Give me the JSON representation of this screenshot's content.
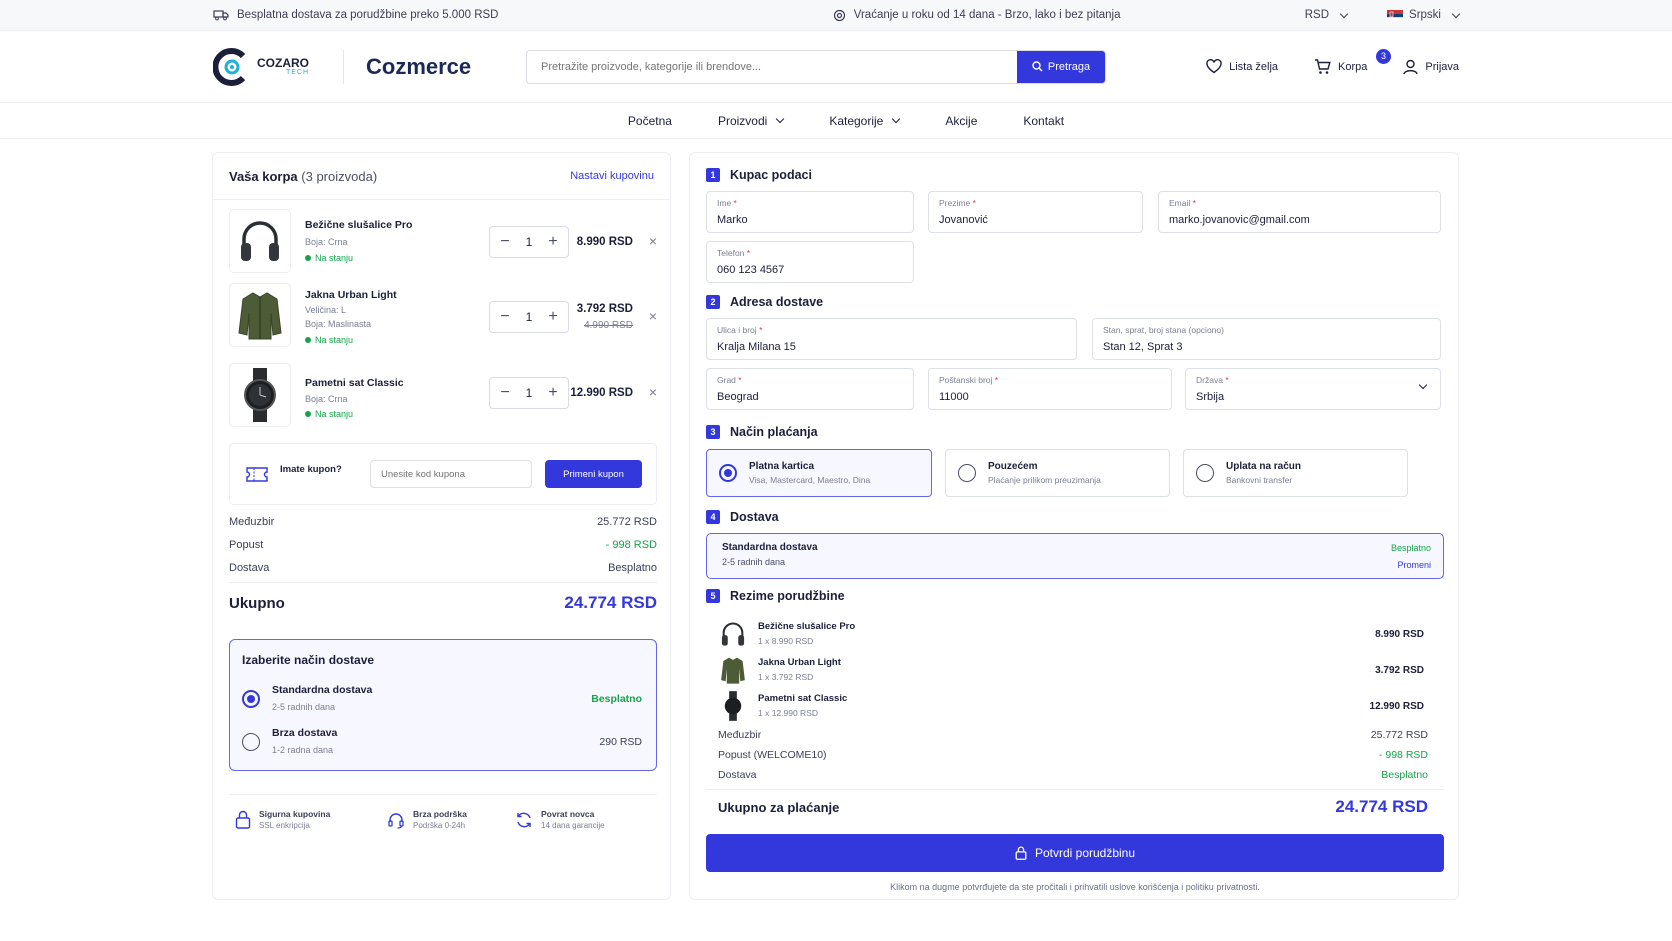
{
  "topbar": {
    "shipping_notice": "Besplatna dostava za porudžbine preko 5.000 RSD",
    "return_notice": "Vraćanje u roku od 14 dana - Brzo, lako i bez pitanja",
    "currency": "RSD",
    "language": "Srpski"
  },
  "header": {
    "logo_main": "COZARO",
    "logo_sub": "TECH",
    "brand": "Cozmerce",
    "search_placeholder": "Pretražite proizvode, kategorije ili brendove...",
    "search_button": "Pretraga",
    "wishlist": "Lista želja",
    "cart": "Korpa",
    "cart_count": "3",
    "login": "Prijava"
  },
  "nav": {
    "items": [
      "Početna",
      "Proizvodi",
      "Kategorije",
      "Akcije",
      "Kontakt"
    ]
  },
  "cart": {
    "title": "Vaša korpa",
    "count_label": "(3 proizvoda)",
    "continue_link": "Nastavi kupovinu",
    "items": [
      {
        "name": "Bežične slušalice Pro",
        "meta1": "Boja: Crna",
        "meta2": "",
        "stock": "Na stanju",
        "qty": "1",
        "price": "8.990 RSD",
        "old_price": ""
      },
      {
        "name": "Jakna Urban Light",
        "meta1": "Veličina: L",
        "meta2": "Boja: Maslinasta",
        "stock": "Na stanju",
        "qty": "1",
        "price": "3.792 RSD",
        "old_price": "4.990 RSD"
      },
      {
        "name": "Pametni sat Classic",
        "meta1": "Boja: Crna",
        "meta2": "",
        "stock": "Na stanju",
        "qty": "1",
        "price": "12.990 RSD",
        "old_price": ""
      }
    ],
    "coupon": {
      "label": "Imate kupon?",
      "placeholder": "Unesite kod kupona",
      "button": "Primeni kupon"
    },
    "summary": {
      "subtotal_label": "Međuzbir",
      "subtotal": "25.772 RSD",
      "discount_label": "Popust",
      "discount": "- 998 RSD",
      "shipping_label": "Dostava",
      "shipping": "Besplatno",
      "total_label": "Ukupno",
      "total": "24.774 RSD"
    },
    "shipping_choice": {
      "title": "Izaberite način dostave",
      "options": [
        {
          "name": "Standardna dostava",
          "time": "2-5 radnih dana",
          "price": "Besplatno"
        },
        {
          "name": "Brza dostava",
          "time": "1-2 radna dana",
          "price": "290 RSD"
        }
      ]
    },
    "trust": [
      {
        "title": "Sigurna kupovina",
        "sub": "SSL enkripcija"
      },
      {
        "title": "Brza podrška",
        "sub": "Podrška 0-24h"
      },
      {
        "title": "Povrat novca",
        "sub": "14 dana garancije"
      }
    ]
  },
  "checkout": {
    "sections": {
      "s1": {
        "num": "1",
        "title": "Kupac podaci"
      },
      "s2": {
        "num": "2",
        "title": "Adresa dostave"
      },
      "s3": {
        "num": "3",
        "title": "Način plaćanja"
      },
      "s4": {
        "num": "4",
        "title": "Dostava"
      },
      "s5": {
        "num": "5",
        "title": "Rezime porudžbine"
      }
    },
    "fields": {
      "first_name": {
        "label": "Ime",
        "value": "Marko"
      },
      "last_name": {
        "label": "Prezime",
        "value": "Jovanović"
      },
      "email": {
        "label": "Email",
        "value": "marko.jovanovic@gmail.com"
      },
      "phone": {
        "label": "Telefon",
        "value": "060 123 4567"
      },
      "street": {
        "label": "Ulica i broj",
        "value": "Kralja Milana 15"
      },
      "apartment": {
        "label": "Stan, sprat, broj stana (opciono)",
        "value": "Stan 12, Sprat 3"
      },
      "city": {
        "label": "Grad",
        "value": "Beograd"
      },
      "postal": {
        "label": "Poštanski broj",
        "value": "11000"
      },
      "country": {
        "label": "Država",
        "value": "Srbija"
      }
    },
    "payment": [
      {
        "title": "Platna kartica",
        "sub": "Visa, Mastercard, Maestro, Dina"
      },
      {
        "title": "Pouzećem",
        "sub": "Plaćanje prilikom preuzimanja"
      },
      {
        "title": "Uplata na račun",
        "sub": "Bankovni transfer"
      }
    ],
    "delivery": {
      "name": "Standardna dostava",
      "time": "2-5 radnih dana",
      "price": "Besplatno",
      "change": "Promeni"
    },
    "order_items": [
      {
        "name": "Bežične slušalice Pro",
        "qty": "1 x 8.990 RSD",
        "price": "8.990 RSD"
      },
      {
        "name": "Jakna Urban Light",
        "qty": "1 x 3.792 RSD",
        "price": "3.792 RSD"
      },
      {
        "name": "Pametni sat Classic",
        "qty": "1 x 12.990 RSD",
        "price": "12.990 RSD"
      }
    ],
    "order_summary": {
      "subtotal_label": "Međuzbir",
      "subtotal": "25.772 RSD",
      "discount_label": "Popust (WELCOME10)",
      "discount": "- 998 RSD",
      "shipping_label": "Dostava",
      "shipping": "Besplatno",
      "total_label": "Ukupno za plaćanje",
      "total": "24.774 RSD"
    },
    "confirm_button": "Potvrdi porudžbinu",
    "terms_note": "Klikom na dugme potvrđujete da ste pročitali i prihvatili uslove korišćenja i politiku privatnosti."
  },
  "colors": {
    "accent": "#3338dd",
    "success": "#16a34a",
    "required": "#e0314b"
  }
}
